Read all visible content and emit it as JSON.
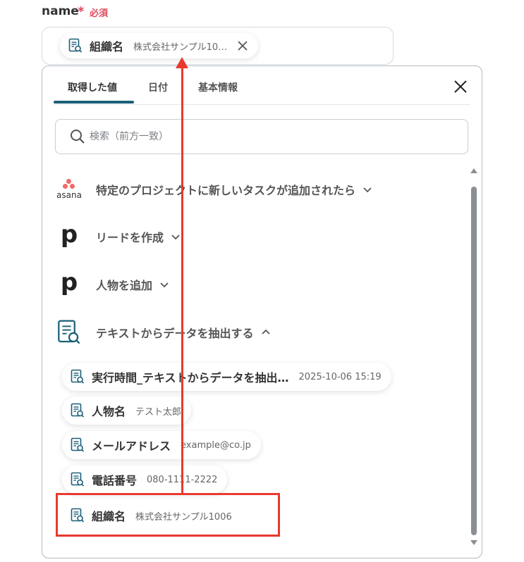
{
  "field": {
    "label": "name",
    "required_mark": "*",
    "required_text": "必須"
  },
  "selected_chip": {
    "title": "組織名",
    "value": "株式会社サンプル10…",
    "close_icon": "close-icon"
  },
  "panel": {
    "tabs": [
      {
        "label": "取得した値",
        "active": true
      },
      {
        "label": "日付",
        "active": false
      },
      {
        "label": "基本情報",
        "active": false
      }
    ],
    "search_placeholder": "検索（前方一致）",
    "sections": [
      {
        "icon": "asana-logo",
        "logo_text": "asana",
        "label": "特定のプロジェクトに新しいタスクが追加されたら",
        "expanded": false
      },
      {
        "icon": "pipedrive-logo",
        "logo_text": "p",
        "label": "リードを作成",
        "expanded": false
      },
      {
        "icon": "pipedrive-logo",
        "logo_text": "p",
        "label": "人物を追加",
        "expanded": false
      },
      {
        "icon": "document-search-icon",
        "logo_text": "",
        "label": "テキストからデータを抽出する",
        "expanded": true
      }
    ],
    "items": [
      {
        "title": "実行時間_テキストからデータを抽出…",
        "value": "2025-10-06 15:19"
      },
      {
        "title": "人物名",
        "value": "テスト太郎"
      },
      {
        "title": "メールアドレス",
        "value": "example@co.jp"
      },
      {
        "title": "電話番号",
        "value": "080-1111-2222"
      },
      {
        "title": "組織名",
        "value": "株式会社サンプル1006"
      }
    ]
  },
  "colors": {
    "accent": "#1b5f79",
    "required": "#e04a5f",
    "annotation": "#e8392e",
    "asana": "#f06a6a"
  }
}
